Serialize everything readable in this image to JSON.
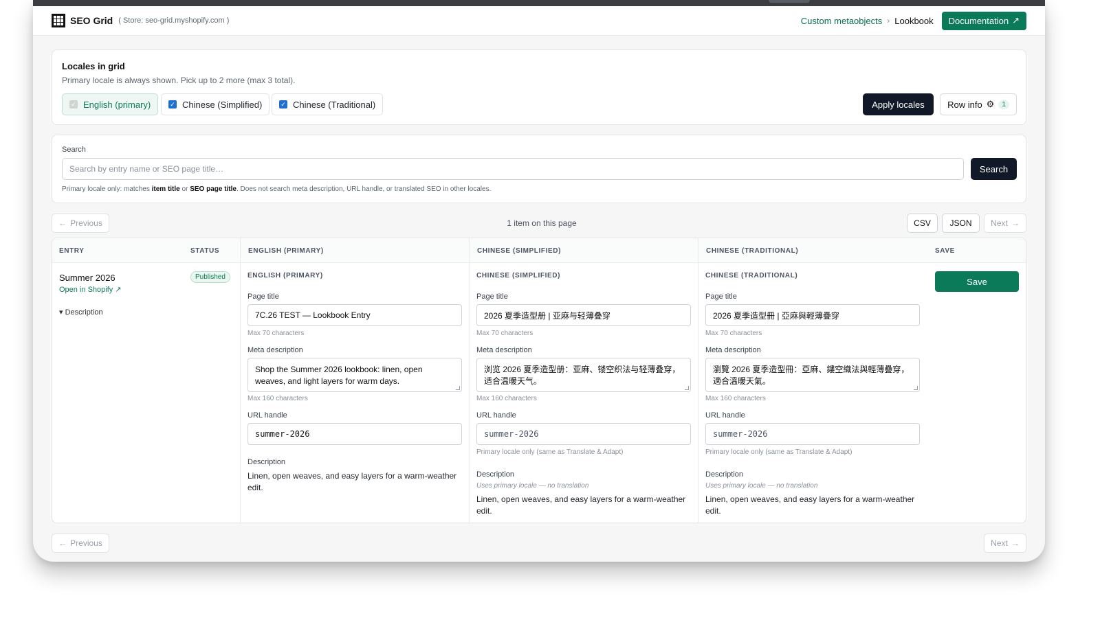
{
  "app": {
    "name": "SEO Grid",
    "store": "( Store: seo-grid.myshopify.com )",
    "breadcrumb": {
      "parent": "Custom metaobjects",
      "separator": "›",
      "current": "Lookbook"
    },
    "doc_button": "Documentation",
    "doc_icon": "↗"
  },
  "locales": {
    "title": "Locales in grid",
    "subtitle": "Primary locale is always shown. Pick up to 2 more (max 3 total).",
    "options": [
      {
        "label": "English (primary)",
        "checked": true,
        "disabled": true
      },
      {
        "label": "Chinese (Simplified)",
        "checked": true
      },
      {
        "label": "Chinese (Traditional)",
        "checked": true
      }
    ],
    "apply_button": "Apply locales",
    "row_info_button": "Row info",
    "row_info_icon": "⚙",
    "row_info_count": "1"
  },
  "search": {
    "label": "Search",
    "placeholder": "Search by entry name or SEO page title…",
    "button": "Search",
    "hint_a": "Primary locale only: matches ",
    "hint_b": "item title",
    "hint_c": " or ",
    "hint_d": "SEO page title",
    "hint_e": ". Does not search meta description, URL handle, or translated SEO in other locales."
  },
  "pagination": {
    "previous": "Previous",
    "next": "Next",
    "prev_icon": "←",
    "next_icon": "→",
    "count": "1 item on this page",
    "csv": "CSV",
    "json": "JSON"
  },
  "table": {
    "headers": {
      "entry": "ENTRY",
      "status": "STATUS",
      "en": "ENGLISH (PRIMARY)",
      "zh_cn": "CHINESE (SIMPLIFIED)",
      "zh_tw": "CHINESE (TRADITIONAL)",
      "save": "SAVE"
    },
    "row": {
      "title": "Summer 2026",
      "open_link": "Open in Shopify ↗",
      "description_toggle": "▾ Description",
      "status": "Published",
      "save_button": "Save",
      "labels": {
        "page_title": "Page title",
        "meta_description": "Meta description",
        "url_handle": "URL handle",
        "description": "Description",
        "max70": "Max 70 characters",
        "max160": "Max 160 characters",
        "primary_only": "Primary locale only (same as Translate & Adapt)",
        "uses_primary": "Uses primary locale — no translation"
      },
      "en": {
        "heading": "ENGLISH (PRIMARY)",
        "page_title": "7C.26 TEST — Lookbook Entry",
        "meta_description": "Shop the Summer 2026 lookbook: linen, open weaves, and light layers for warm days.",
        "url_handle": "summer-2026",
        "description": "Linen, open weaves, and easy layers for a warm-weather edit."
      },
      "zh_cn": {
        "heading": "CHINESE (SIMPLIFIED)",
        "page_title": "2026 夏季造型册 | 亚麻与轻薄叠穿",
        "meta_description": "浏览 2026 夏季造型册：亚麻、镂空织法与轻薄叠穿，适合温暖天气。",
        "url_handle": "summer-2026",
        "description": "Linen, open weaves, and easy layers for a warm-weather edit."
      },
      "zh_tw": {
        "heading": "CHINESE (TRADITIONAL)",
        "page_title": "2026 夏季造型冊 | 亞麻與輕薄疊穿",
        "meta_description": "瀏覽 2026 夏季造型冊：亞麻、鏤空織法與輕薄疊穿，適合溫暖天氣。",
        "url_handle": "summer-2026",
        "description": "Linen, open weaves, and easy layers for a warm-weather edit."
      }
    }
  },
  "colors": {
    "accent": "#0b7a58",
    "dark": "#111827",
    "checkbox": "#1f6fd1"
  }
}
